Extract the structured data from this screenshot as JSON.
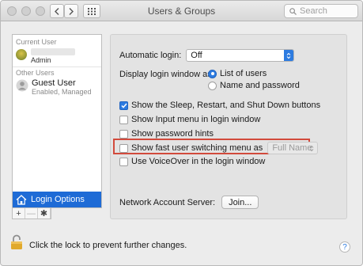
{
  "window": {
    "title": "Users & Groups",
    "search_placeholder": "Search"
  },
  "sidebar": {
    "current_user_label": "Current User",
    "current_user_role": "Admin",
    "other_users_label": "Other Users",
    "guest_name": "Guest User",
    "guest_status": "Enabled, Managed",
    "login_options_label": "Login Options",
    "add_symbol": "+",
    "remove_symbol": "—",
    "gear_symbol": "✱"
  },
  "login": {
    "automatic_login_label": "Automatic login:",
    "automatic_login_value": "Off",
    "display_label": "Display login window as:",
    "option_list": "List of users",
    "option_name": "Name and password",
    "selected_option": "List of users"
  },
  "options": {
    "sleep_restart": "Show the Sleep, Restart, and Shut Down buttons",
    "input_menu": "Show Input menu in login window",
    "password_hints": "Show password hints",
    "fast_user_switching": "Show fast user switching menu as",
    "fast_user_switching_value": "Full Name",
    "voiceover": "Use VoiceOver in the login window"
  },
  "network": {
    "label": "Network Account Server:",
    "join_button": "Join..."
  },
  "footer": {
    "lock_text": "Click the lock to prevent further changes.",
    "help_symbol": "?"
  },
  "colors": {
    "accent": "#2d7be0",
    "selection": "#1e6bd6",
    "highlight_box": "#d24a3c"
  }
}
